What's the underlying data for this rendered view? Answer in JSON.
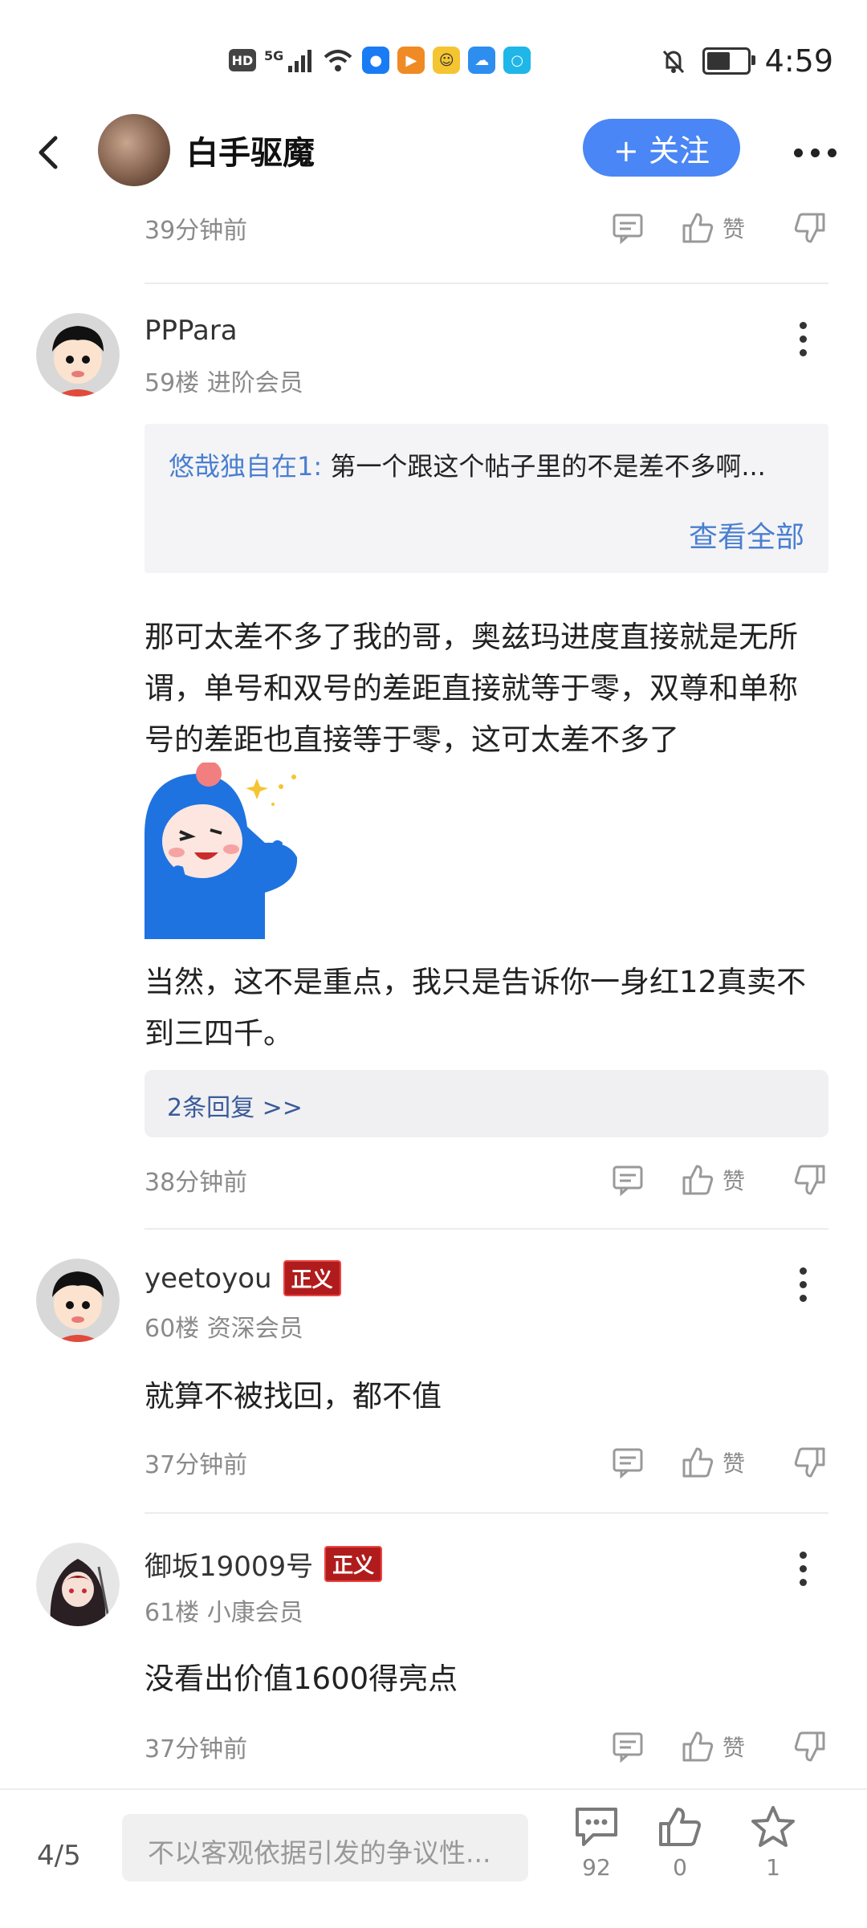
{
  "status_bar": {
    "hd": "HD",
    "net": "5G",
    "time": "4:59"
  },
  "header": {
    "user_name": "白手驱魔",
    "follow_label": "+ 关注"
  },
  "prev_comment": {
    "time": "39分钟前",
    "like_label": "赞"
  },
  "comments": [
    {
      "user": "PPPara",
      "floor": "59楼 进阶会员",
      "quote_user": "悠哉独自在1:",
      "quote_text": " 第一个跟这个帖子里的不是差不多啊...",
      "quote_all": "查看全部",
      "text1": "那可太差不多了我的哥，奥兹玛进度直接就是无所谓，单号和双号的差距直接就等于零，双尊和单称号的差距也直接等于零，这可太差不多了",
      "text2": "当然，这不是重点，我只是告诉你一身红12真卖不到三四千。",
      "replies": "2条回复 >>",
      "time": "38分钟前",
      "like_label": "赞"
    },
    {
      "user": "yeetoyou",
      "badge": "正义",
      "floor": "60楼 资深会员",
      "text": "就算不被找回，都不值",
      "time": "37分钟前",
      "like_label": "赞"
    },
    {
      "user": "御坂19009号",
      "badge": "正义",
      "floor": "61楼 小康会员",
      "text": "没看出价值1600得亮点",
      "time": "37分钟前",
      "like_label": "赞"
    }
  ],
  "bottom_bar": {
    "page": "4/5",
    "input_placeholder": "不以客观依据引发的争议性...",
    "comment_count": "92",
    "like_count": "0",
    "star_count": "1"
  },
  "icons": [
    "back-arrow-icon",
    "more-icon",
    "comment-icon",
    "thumbs-up-icon",
    "thumbs-down-icon",
    "kebab-icon",
    "star-icon",
    "mute-bell-icon",
    "wifi-icon",
    "signal-icon",
    "battery-icon"
  ],
  "colors": {
    "accent": "#4a86f5",
    "link": "#4a7fd0",
    "badge": "#b01c1c"
  }
}
